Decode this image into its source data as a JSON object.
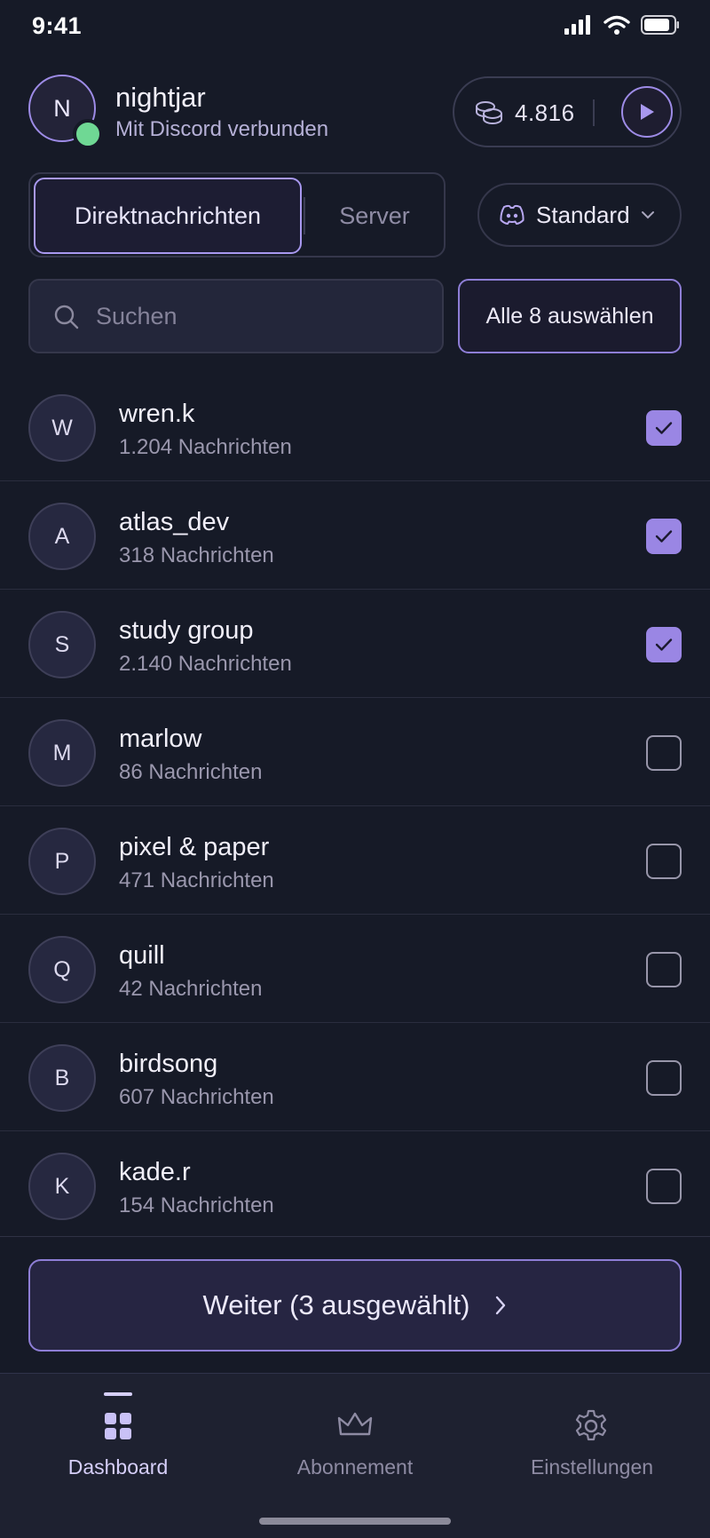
{
  "status_bar": {
    "time": "9:41"
  },
  "profile": {
    "initial": "N",
    "name": "nightjar",
    "subtitle": "Mit Discord verbunden"
  },
  "credits": {
    "value": "4.816"
  },
  "tabs": {
    "active": "Direktnachrichten",
    "inactive": "Server"
  },
  "mode": {
    "label": "Standard"
  },
  "search": {
    "placeholder": "Suchen",
    "value": ""
  },
  "select_all": {
    "label": "Alle 8 auswählen"
  },
  "conversations": [
    {
      "initial": "W",
      "name": "wren.k",
      "count": "1.204 Nachrichten",
      "checked": true
    },
    {
      "initial": "A",
      "name": "atlas_dev",
      "count": "318 Nachrichten",
      "checked": true
    },
    {
      "initial": "S",
      "name": "study group",
      "count": "2.140 Nachrichten",
      "checked": true
    },
    {
      "initial": "M",
      "name": "marlow",
      "count": "86 Nachrichten",
      "checked": false
    },
    {
      "initial": "P",
      "name": "pixel & paper",
      "count": "471 Nachrichten",
      "checked": false
    },
    {
      "initial": "Q",
      "name": "quill",
      "count": "42 Nachrichten",
      "checked": false
    },
    {
      "initial": "B",
      "name": "birdsong",
      "count": "607 Nachrichten",
      "checked": false
    },
    {
      "initial": "K",
      "name": "kade.r",
      "count": "154 Nachrichten",
      "checked": false
    }
  ],
  "continue_button": {
    "label": "Weiter (3 ausgewählt)"
  },
  "bottom_nav": {
    "dashboard": "Dashboard",
    "subscription": "Abonnement",
    "settings": "Einstellungen",
    "active": "dashboard"
  },
  "colors": {
    "accent": "#9a86e4",
    "online": "#6fd894",
    "background": "#161a27"
  }
}
